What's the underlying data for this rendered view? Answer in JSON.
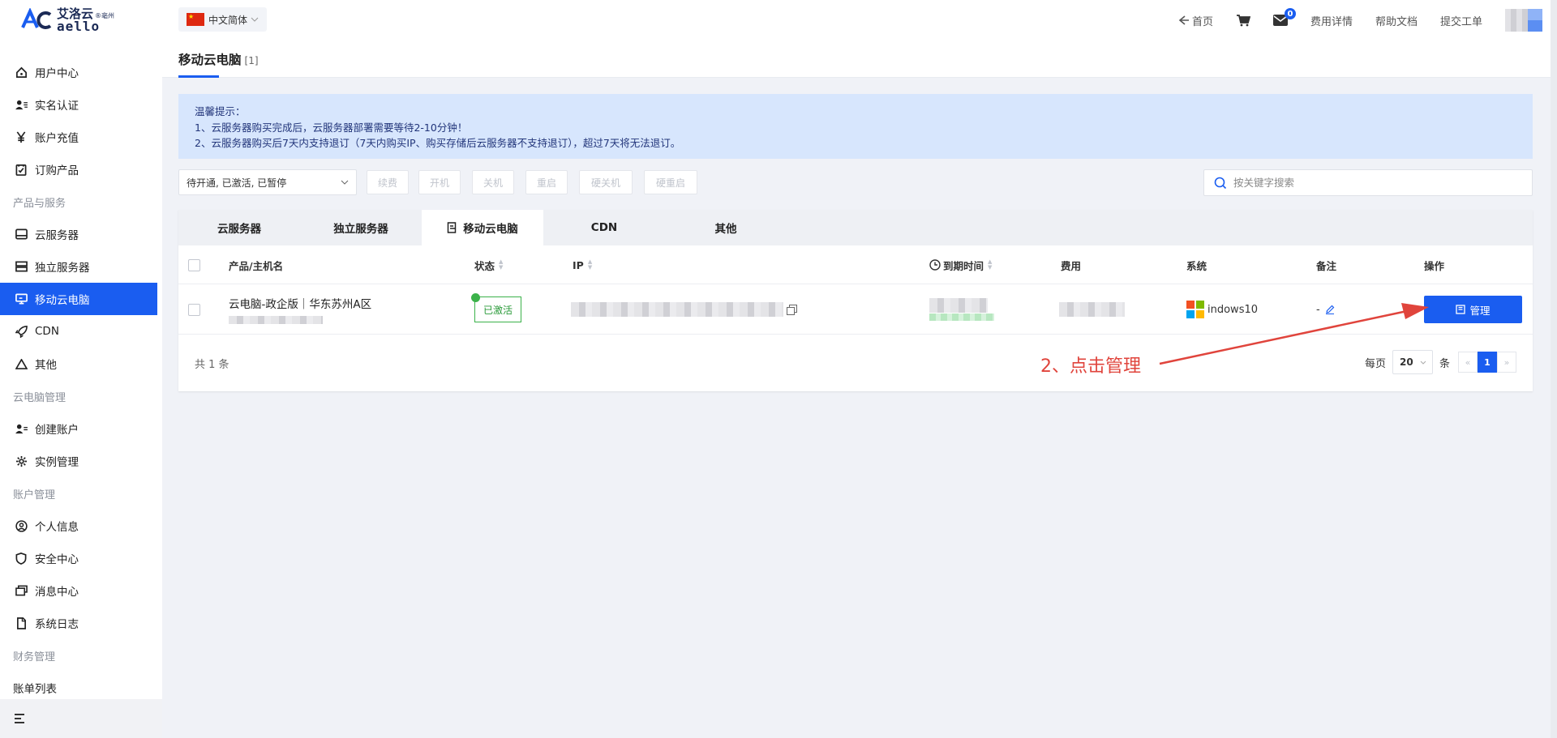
{
  "brand": {
    "logo_cn": "艾洛云",
    "logo_sub": "®亳州",
    "logo_en": "aello"
  },
  "sidebar": {
    "items": [
      {
        "type": "item",
        "label": "用户中心",
        "icon": "home-icon"
      },
      {
        "type": "item",
        "label": "实名认证",
        "icon": "id-card-icon"
      },
      {
        "type": "item",
        "label": "账户充值",
        "icon": "yen-icon"
      },
      {
        "type": "item",
        "label": "订购产品",
        "icon": "order-icon"
      },
      {
        "type": "group",
        "label": "产品与服务"
      },
      {
        "type": "item",
        "label": "云服务器",
        "icon": "server-icon"
      },
      {
        "type": "item",
        "label": "独立服务器",
        "icon": "rack-server-icon"
      },
      {
        "type": "item",
        "label": "移动云电脑",
        "icon": "monitor-icon",
        "active": true
      },
      {
        "type": "item",
        "label": "CDN",
        "icon": "rocket-icon"
      },
      {
        "type": "item",
        "label": "其他",
        "icon": "triangle-icon"
      },
      {
        "type": "group",
        "label": "云电脑管理"
      },
      {
        "type": "item",
        "label": "创建账户",
        "icon": "user-add-icon"
      },
      {
        "type": "item",
        "label": "实例管理",
        "icon": "gear-icon"
      },
      {
        "type": "group",
        "label": "账户管理"
      },
      {
        "type": "item",
        "label": "个人信息",
        "icon": "user-circle-icon"
      },
      {
        "type": "item",
        "label": "安全中心",
        "icon": "shield-icon"
      },
      {
        "type": "item",
        "label": "消息中心",
        "icon": "message-icon"
      },
      {
        "type": "item",
        "label": "系统日志",
        "icon": "file-icon"
      },
      {
        "type": "group",
        "label": "财务管理"
      },
      {
        "type": "plain",
        "label": "账单列表"
      }
    ]
  },
  "topbar": {
    "language": "中文简体",
    "home": "首页",
    "cart_icon": "cart-icon",
    "message_count": "0",
    "links": [
      "费用详情",
      "帮助文档",
      "提交工单"
    ]
  },
  "page": {
    "title": "移动云电脑",
    "count": "[1]"
  },
  "notice": {
    "title": "温馨提示：",
    "line1": "1、云服务器购买完成后，云服务器部署需要等待2-10分钟！",
    "line2": "2、云服务器购买后7天内支持退订（7天内购买IP、购买存储后云服务器不支持退订），超过7天将无法退订。"
  },
  "filter": {
    "status_value": "待开通, 已激活, 已暂停",
    "buttons": [
      "续费",
      "开机",
      "关机",
      "重启",
      "硬关机",
      "硬重启"
    ],
    "search_placeholder": "按关键字搜索"
  },
  "tabs": [
    {
      "label": "云服务器"
    },
    {
      "label": "独立服务器"
    },
    {
      "label": "移动云电脑",
      "active": true
    },
    {
      "label": "CDN"
    },
    {
      "label": "其他"
    }
  ],
  "table": {
    "columns": [
      "产品/主机名",
      "状态",
      "IP",
      "到期时间",
      "费用",
      "系统",
      "备注",
      "操作"
    ],
    "rows": [
      {
        "product": "云电脑-政企版｜华东苏州A区",
        "status": "已激活",
        "os": "indows10",
        "note": "-",
        "action": "管理"
      }
    ]
  },
  "footer": {
    "total": "共 1 条",
    "per_page_label": "每页",
    "per_page_value": "20",
    "per_page_unit": "条",
    "current_page": "1",
    "prev": "«",
    "next": "»"
  },
  "annotation": {
    "text": "2、点击管理",
    "color": "#e0443c"
  },
  "colors": {
    "primary": "#1a5df0",
    "success": "#3bb24a",
    "notice_bg": "#d7e6fd"
  }
}
